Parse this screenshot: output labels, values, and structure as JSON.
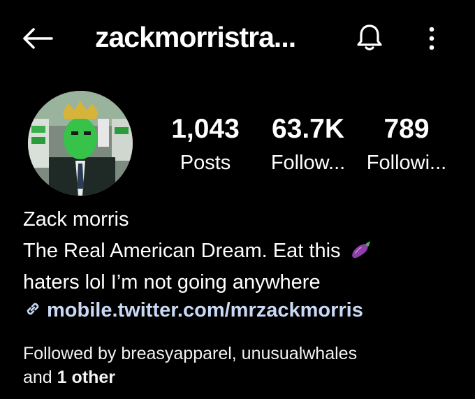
{
  "header": {
    "username": "zackmorristra...",
    "back_icon": "arrow-left-icon",
    "notify_icon": "bell-icon",
    "more_icon": "more-vertical-icon"
  },
  "profile": {
    "avatar_icon": "profile-photo",
    "stats": {
      "posts": {
        "value": "1,043",
        "label": "Posts"
      },
      "followers": {
        "value": "63.7K",
        "label": "Follow..."
      },
      "following": {
        "value": "789",
        "label": "Followi..."
      }
    }
  },
  "bio": {
    "name": "Zack morris",
    "line1": "The Real American Dream. Eat this",
    "emoji": "eggplant",
    "line2": "haters lol I’m not going anywhere",
    "link": "mobile.twitter.com/mrzackmorris"
  },
  "followed_by": {
    "prefix": "Followed by breasyapparel, unusualwhales",
    "and": "and",
    "other": "1 other"
  },
  "colors": {
    "background": "#000000",
    "text": "#ffffff",
    "link": "#c9d9f5",
    "eggplant": "#8e3fa8"
  }
}
